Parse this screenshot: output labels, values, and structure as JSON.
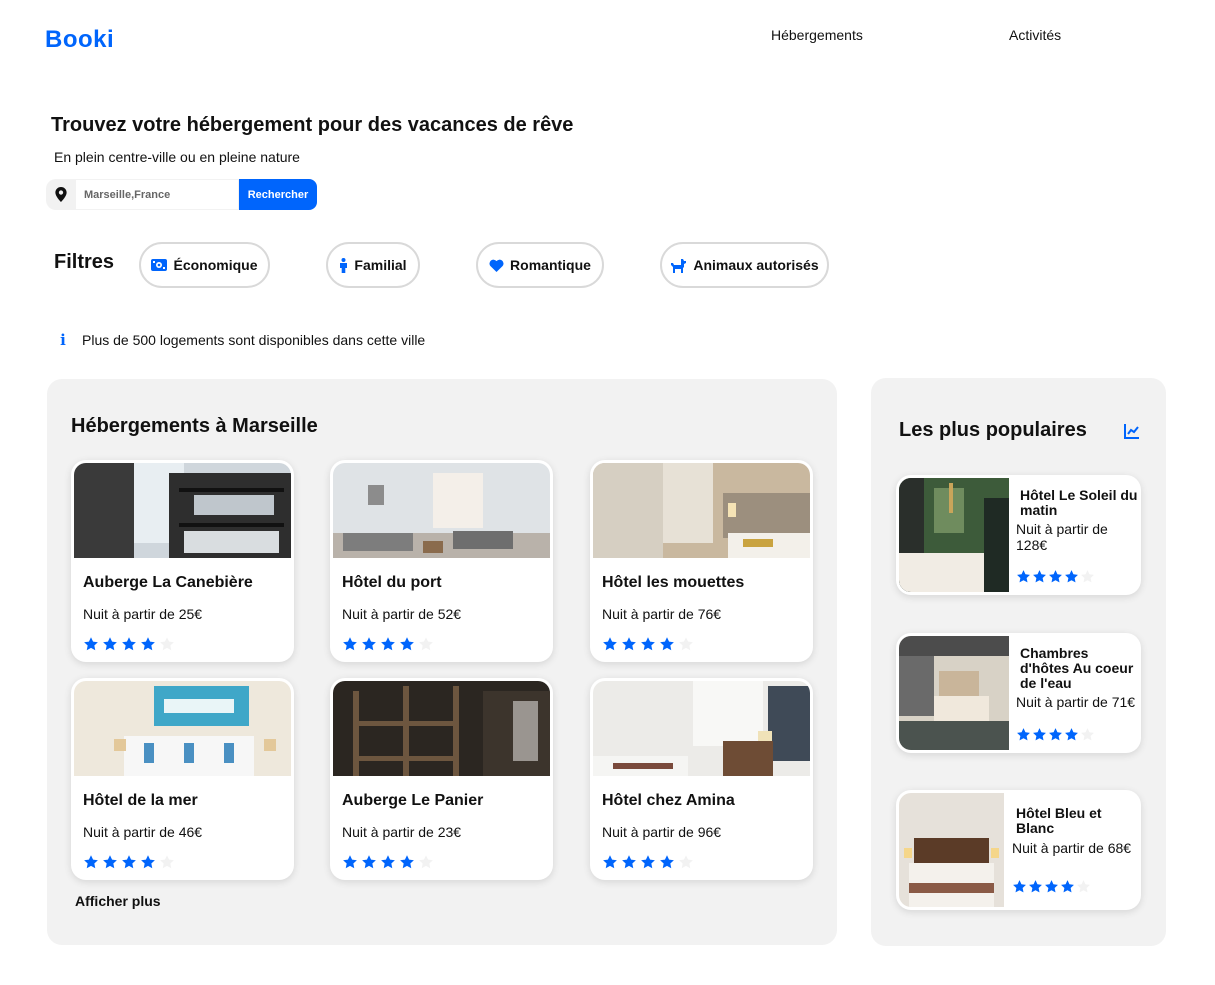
{
  "header": {
    "logo": "Booki",
    "nav": [
      "Hébergements",
      "Activités"
    ]
  },
  "hero": {
    "title": "Trouvez votre hébergement pour des vacances de rêve",
    "subtitle": "En plein centre-ville ou en pleine nature"
  },
  "search": {
    "placeholder": "Marseille,France",
    "button": "Rechercher",
    "icon": "map-pin-icon"
  },
  "filters": {
    "label": "Filtres",
    "items": [
      {
        "label": "Économique",
        "icon": "money-icon"
      },
      {
        "label": "Familial",
        "icon": "person-icon"
      },
      {
        "label": "Romantique",
        "icon": "heart-icon"
      },
      {
        "label": "Animaux autorisés",
        "icon": "dog-icon"
      }
    ]
  },
  "info": {
    "icon": "info-icon",
    "text": "Plus de 500 logements sont disponibles dans cette ville"
  },
  "accommodations": {
    "title": "Hébergements à Marseille",
    "items": [
      {
        "name": "Auberge La Canebière",
        "price": "Nuit à partir de 25€",
        "rating": 4
      },
      {
        "name": "Hôtel du port",
        "price": "Nuit à partir de 52€",
        "rating": 4
      },
      {
        "name": "Hôtel les mouettes",
        "price": "Nuit à partir de 76€",
        "rating": 4
      },
      {
        "name": "Hôtel de la mer",
        "price": "Nuit à partir de 46€",
        "rating": 4
      },
      {
        "name": "Auberge Le Panier",
        "price": "Nuit à partir de 23€",
        "rating": 4
      },
      {
        "name": "Hôtel chez Amina",
        "price": "Nuit à partir de 96€",
        "rating": 4
      }
    ],
    "more": "Afficher plus"
  },
  "popular": {
    "title": "Les plus populaires",
    "icon": "trending-chart-icon",
    "items": [
      {
        "name": "Hôtel Le Soleil du matin",
        "price": "Nuit à partir de 128€",
        "rating": 4
      },
      {
        "name": "Chambres d'hôtes Au coeur de l'eau",
        "price": "Nuit à partir de 71€",
        "rating": 4
      },
      {
        "name": "Hôtel Bleu et Blanc",
        "price": "Nuit à partir de 68€",
        "rating": 4
      }
    ]
  },
  "colors": {
    "primary": "#0065fc",
    "panel": "#f2f2f2",
    "star_empty": "#f2f2f2"
  }
}
